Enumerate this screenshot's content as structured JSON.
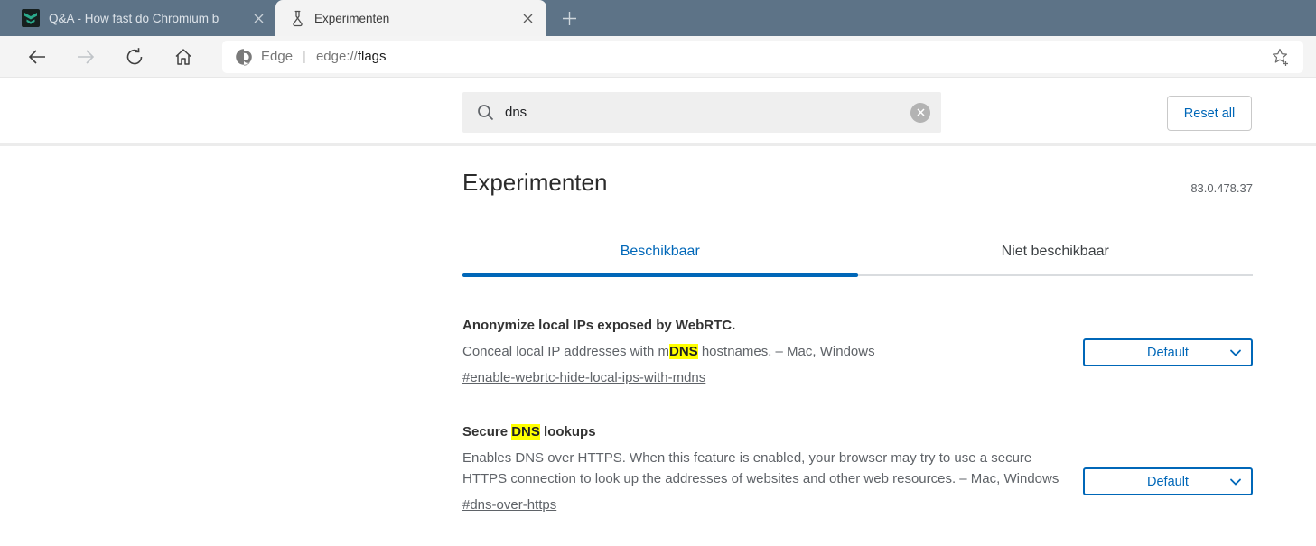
{
  "browser": {
    "tab_bar": {
      "tabs": [
        {
          "title": "Q&A - How fast do Chromium b",
          "icon": "qa-favicon"
        },
        {
          "title": "Experimenten",
          "icon": "flask-icon"
        }
      ]
    },
    "address_bar": {
      "site_label": "Edge",
      "separator": "|",
      "url_scheme": "edge://",
      "url_path": "flags"
    }
  },
  "page": {
    "search": {
      "value": "dns"
    },
    "reset_all_label": "Reset all",
    "title": "Experimenten",
    "version": "83.0.478.37",
    "section_tabs": {
      "available": "Beschikbaar",
      "unavailable": "Niet beschikbaar"
    },
    "flags": [
      {
        "title_segments": [
          {
            "t": "Anonymize local IPs exposed by WebRTC."
          }
        ],
        "desc_segments": [
          {
            "t": "Conceal local IP addresses with m"
          },
          {
            "t": "DNS",
            "hl": true
          },
          {
            "t": " hostnames. – Mac, Windows"
          }
        ],
        "link": "#enable-webrtc-hide-local-ips-with-mdns",
        "value": "Default"
      },
      {
        "title_segments": [
          {
            "t": "Secure "
          },
          {
            "t": "DNS",
            "hl": true
          },
          {
            "t": " lookups"
          }
        ],
        "desc_segments": [
          {
            "t": "Enables DNS over HTTPS. When this feature is enabled, your browser may try to use a secure HTTPS connection to look up the addresses of websites and other web resources. – Mac, Windows"
          }
        ],
        "link": "#dns-over-https",
        "value": "Default"
      }
    ]
  },
  "colors": {
    "accent_blue": "#0067b8",
    "tab_bar_background": "#5d7387",
    "toolbar_background": "#f4f4f4",
    "search_highlight": "#ffff00"
  }
}
